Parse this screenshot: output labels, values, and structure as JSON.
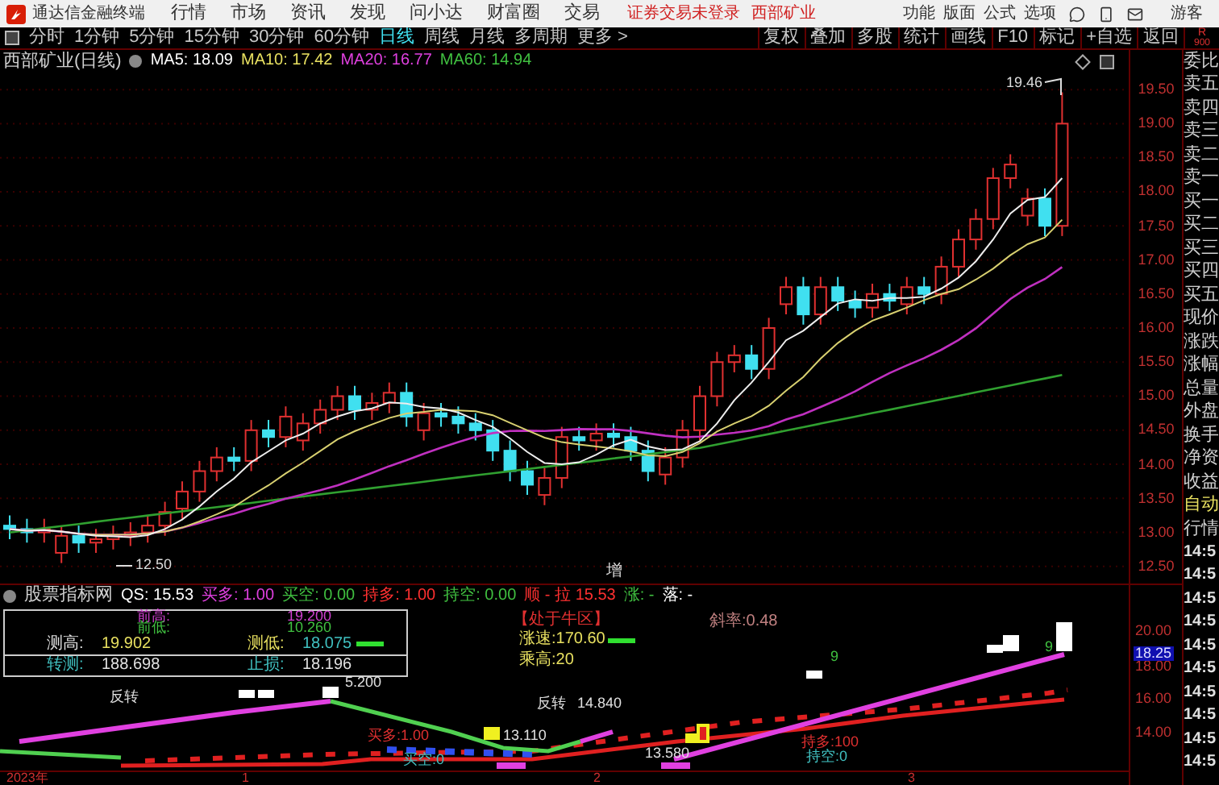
{
  "title_bar": {
    "app_name": "通达信金融终端",
    "menus": [
      "行情",
      "市场",
      "资讯",
      "发现",
      "问小达",
      "财富圈",
      "交易"
    ],
    "login_status": "证券交易未登录",
    "stock_name": "西部矿业",
    "right_menus": [
      "功能",
      "版面",
      "公式",
      "选项"
    ],
    "user": "游客"
  },
  "period_bar": {
    "periods": [
      {
        "label": "分时",
        "selected": false
      },
      {
        "label": "1分钟",
        "selected": false
      },
      {
        "label": "5分钟",
        "selected": false
      },
      {
        "label": "15分钟",
        "selected": false
      },
      {
        "label": "30分钟",
        "selected": false
      },
      {
        "label": "60分钟",
        "selected": false
      },
      {
        "label": "日线",
        "selected": true
      },
      {
        "label": "周线",
        "selected": false
      },
      {
        "label": "月线",
        "selected": false
      },
      {
        "label": "多周期",
        "selected": false
      },
      {
        "label": "更多 >",
        "selected": false
      }
    ],
    "tools": [
      "复权",
      "叠加",
      "多股",
      "统计",
      "画线",
      "F10",
      "标记",
      "+自选",
      "返回"
    ],
    "corner_label": "R",
    "corner_value": "900"
  },
  "chart": {
    "title": "西部矿业(日线)",
    "ma": [
      {
        "label": "MA5: 18.09",
        "color": "#ffffff"
      },
      {
        "label": "MA10: 17.42",
        "color": "#e8e060"
      },
      {
        "label": "MA20: 16.77",
        "color": "#e040e0"
      },
      {
        "label": "MA60: 14.94",
        "color": "#40c040"
      }
    ],
    "high_marker": "19.46",
    "low_marker": "12.50",
    "center_mark": "增",
    "price_axis": [
      "19.50",
      "19.00",
      "18.50",
      "18.00",
      "17.50",
      "17.00",
      "16.50",
      "16.00",
      "15.50",
      "15.00",
      "14.50",
      "14.00",
      "13.50",
      "13.00",
      "12.50"
    ]
  },
  "quote_panel": {
    "labels": [
      "委比",
      "卖五",
      "卖四",
      "卖三",
      "卖二",
      "卖一",
      "买一",
      "买二",
      "买三",
      "买四",
      "买五",
      "现价",
      "涨跌",
      "涨幅",
      "总量",
      "外盘",
      "换手",
      "净资",
      "收益",
      "自动",
      "行情"
    ],
    "times": [
      "14:5",
      "14:5",
      "14:5",
      "14:5",
      "14:5",
      "14:5",
      "14:5",
      "14:5",
      "14:5",
      "14:5"
    ]
  },
  "indicator": {
    "title": "股票指标网",
    "header": [
      {
        "text": "QS: 15.53",
        "color": "#ffffff"
      },
      {
        "text": "买多: 1.00",
        "color": "#e040e0"
      },
      {
        "text": "买空: 0.00",
        "color": "#40c040"
      },
      {
        "text": "持多: 1.00",
        "color": "#ff3030"
      },
      {
        "text": "持空: 0.00",
        "color": "#40c040"
      },
      {
        "text": "顺 - 拉 15.53",
        "color": "#ff3030"
      },
      {
        "text": "涨: -",
        "color": "#40c040"
      },
      {
        "text": "落: -",
        "color": "#ffffff"
      }
    ],
    "table": {
      "top": [
        {
          "label": "前高:",
          "value": "19.200"
        },
        {
          "label": "前低:",
          "value": "10.260"
        }
      ],
      "rows": [
        [
          {
            "label": "测高:",
            "value": "19.902"
          },
          {
            "label": "测低:",
            "value": "18.075"
          }
        ],
        [
          {
            "label": "转测:",
            "value": "188.698"
          },
          {
            "label": "止损:",
            "value": "18.196"
          }
        ]
      ]
    },
    "status": "【处于牛区】",
    "speed": "涨速:170.60",
    "multiple": "乘高:20",
    "slope": "斜率:0.48",
    "chart_labels": [
      "反转",
      "5.200",
      "反转",
      "14.840",
      "13.110",
      "13.580",
      "9",
      "9",
      "买多:1.00",
      "买空:0",
      "持多:100",
      "持空:0"
    ],
    "axis": [
      {
        "text": "20.00",
        "selected": false
      },
      {
        "text": "18.25",
        "selected": true
      },
      {
        "text": "18.00",
        "selected": false
      },
      {
        "text": "16.00",
        "selected": false
      },
      {
        "text": "14.00",
        "selected": false
      }
    ]
  },
  "date_axis": [
    "2023年",
    "1",
    "2",
    "3"
  ]
}
